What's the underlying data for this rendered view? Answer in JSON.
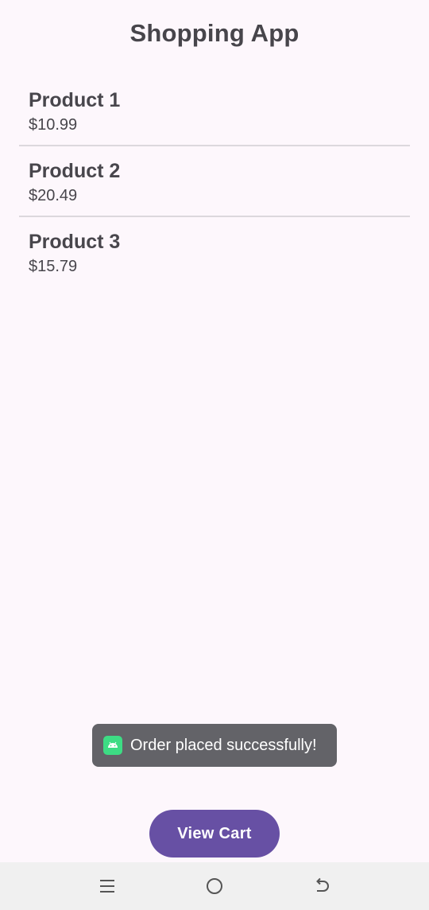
{
  "app": {
    "title": "Shopping App"
  },
  "products": [
    {
      "name": "Product 1",
      "price": "$10.99"
    },
    {
      "name": "Product 2",
      "price": "$20.49"
    },
    {
      "name": "Product 3",
      "price": "$15.79"
    }
  ],
  "toast": {
    "message": "Order placed successfully!",
    "icon": "android-app-icon"
  },
  "actions": {
    "view_cart_label": "View Cart"
  },
  "navigation_bar": {
    "buttons": [
      "recent-apps-icon",
      "home-icon",
      "back-icon"
    ]
  },
  "colors": {
    "background": "#fdf7fc",
    "primary": "#6750a4",
    "toast_background": "#636368",
    "divider": "#dcd8dd",
    "nav_bar": "#f0f0f0"
  }
}
